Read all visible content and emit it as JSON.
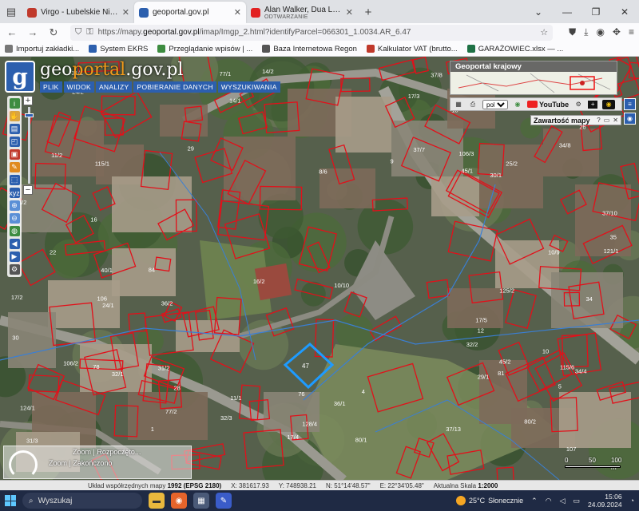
{
  "browser": {
    "tabs": [
      {
        "title": "Virgo - Lubelskie Nieruchomości",
        "color": "#c0392b",
        "active": false
      },
      {
        "title": "geoportal.gov.pl",
        "color": "#2c5fae",
        "active": true
      },
      {
        "title": "Alan Walker, Dua Lipa, Coldplay",
        "subtitle": "ODTWARZANIE",
        "color": "#e22222",
        "active": false
      }
    ],
    "new_tab": "+",
    "url_prefix": "https://mapy.",
    "url_domain": "geoportal.gov.pl",
    "url_rest": "/imap/Imgp_2.html?identifyParcel=066301_1.0034.AR_6.47",
    "bookmarks": [
      {
        "label": "Importuj zakładki...",
        "color": "#777777"
      },
      {
        "label": "System EKRS",
        "color": "#2c5fae"
      },
      {
        "label": "Przeglądanie wpisów | ...",
        "color": "#3d8c40"
      },
      {
        "label": "Baza Internetowa Regon",
        "color": "#555555"
      },
      {
        "label": "Kalkulator VAT (brutto...",
        "color": "#c0392b"
      },
      {
        "label": "GARAŻOWIEC.xlsx — ...",
        "color": "#1e7145"
      }
    ]
  },
  "geoportal": {
    "logo_letter": "g",
    "brand_part1": "geo",
    "brand_part2": "portal",
    "brand_part3": ".gov.pl",
    "menu": [
      "PLIK",
      "WIDOK",
      "ANALIZY",
      "POBIERANIE DANYCH",
      "WYSZUKIWANIA"
    ],
    "overview_title": "Geoportal krajowy",
    "language": "pol",
    "youtube": "YouTube",
    "content_panel_title": "Zawartość mapy",
    "content_panel_help": "?",
    "zoom_label": "Zoom | Rozpoczęto...",
    "zoom_label2": "Zoom | Zakończono",
    "scale_labels": [
      "0",
      "50",
      "100 m"
    ]
  },
  "parcels": {
    "labels": [
      "78",
      "77/1",
      "77/2",
      "76",
      "80/1",
      "80/2",
      "81",
      "84",
      "1/1",
      "17/4",
      "17/3",
      "17/2",
      "17/5",
      "13",
      "1",
      "11/2",
      "40/1",
      "41/2",
      "37/8",
      "37/9",
      "37/7",
      "37/10",
      "37/13",
      "36/1",
      "36/2",
      "35",
      "34",
      "37/12",
      "31/3",
      "31/2",
      "31/1",
      "32/1",
      "32/2",
      "32/3",
      "45/1",
      "45/2",
      "107",
      "106/2",
      "106/3",
      "106",
      "10/10",
      "10/9",
      "14/1",
      "14/2",
      "4",
      "5",
      "22",
      "24/1",
      "24/2",
      "25/2",
      "26",
      "29",
      "30",
      "28",
      "125/2",
      "128/3",
      "128/4",
      "121/1",
      "124/1",
      "115/6",
      "115/1",
      "8/6",
      "10",
      "9",
      "12",
      "18",
      "29/1",
      "16",
      "30/1",
      "34/8",
      "34/4",
      "16/2",
      "11/1"
    ],
    "highlight": "47"
  },
  "statusbar": {
    "coord_system_label": "Układ współrzędnych mapy",
    "coord_system": "1992 (EPSG 2180)",
    "x": "X: 381617.93",
    "y": "Y: 748938.21",
    "n": "N: 51°14'48.57\"",
    "e": "E: 22°34'05.48\"",
    "scale_label": "Aktualna Skala",
    "scale": "1:2000"
  },
  "taskbar": {
    "search_placeholder": "Wyszukaj",
    "weather": "25°C",
    "weather_desc": "Słonecznie",
    "time": "15:06",
    "date": "24.09.2024"
  }
}
